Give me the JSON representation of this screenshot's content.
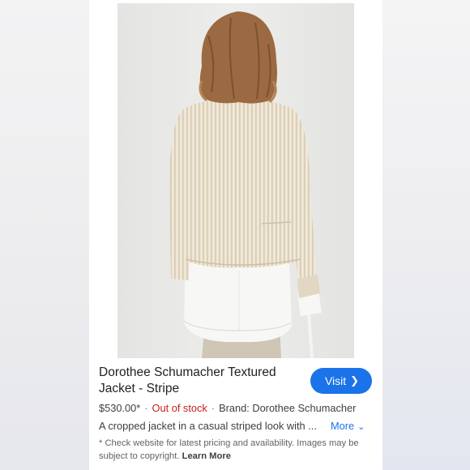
{
  "product": {
    "title": "Dorothee Schumacher Textured Jacket - Stripe",
    "price": "$530.00*",
    "stock_status": "Out of stock",
    "brand": "Brand: Dorothee Schumacher",
    "description": "A cropped jacket in a casual striped look with ...",
    "more_label": "More",
    "image_alt": "Back view of model wearing a cream striped textured jacket over a white shirt"
  },
  "actions": {
    "visit_label": "Visit"
  },
  "disclaimer": {
    "text": "* Check website for latest pricing and availability. Images may be subject to copyright. ",
    "learn_more": "Learn More"
  },
  "colors": {
    "accent": "#1a73e8",
    "out_of_stock": "#c5221f",
    "jacket": "#e9dfcc",
    "shirt": "#f7f7f5",
    "hair": "#9b6a42"
  },
  "icons": {
    "visit_chevron": "chevron-right-icon",
    "more_chevron": "chevron-down-icon"
  }
}
